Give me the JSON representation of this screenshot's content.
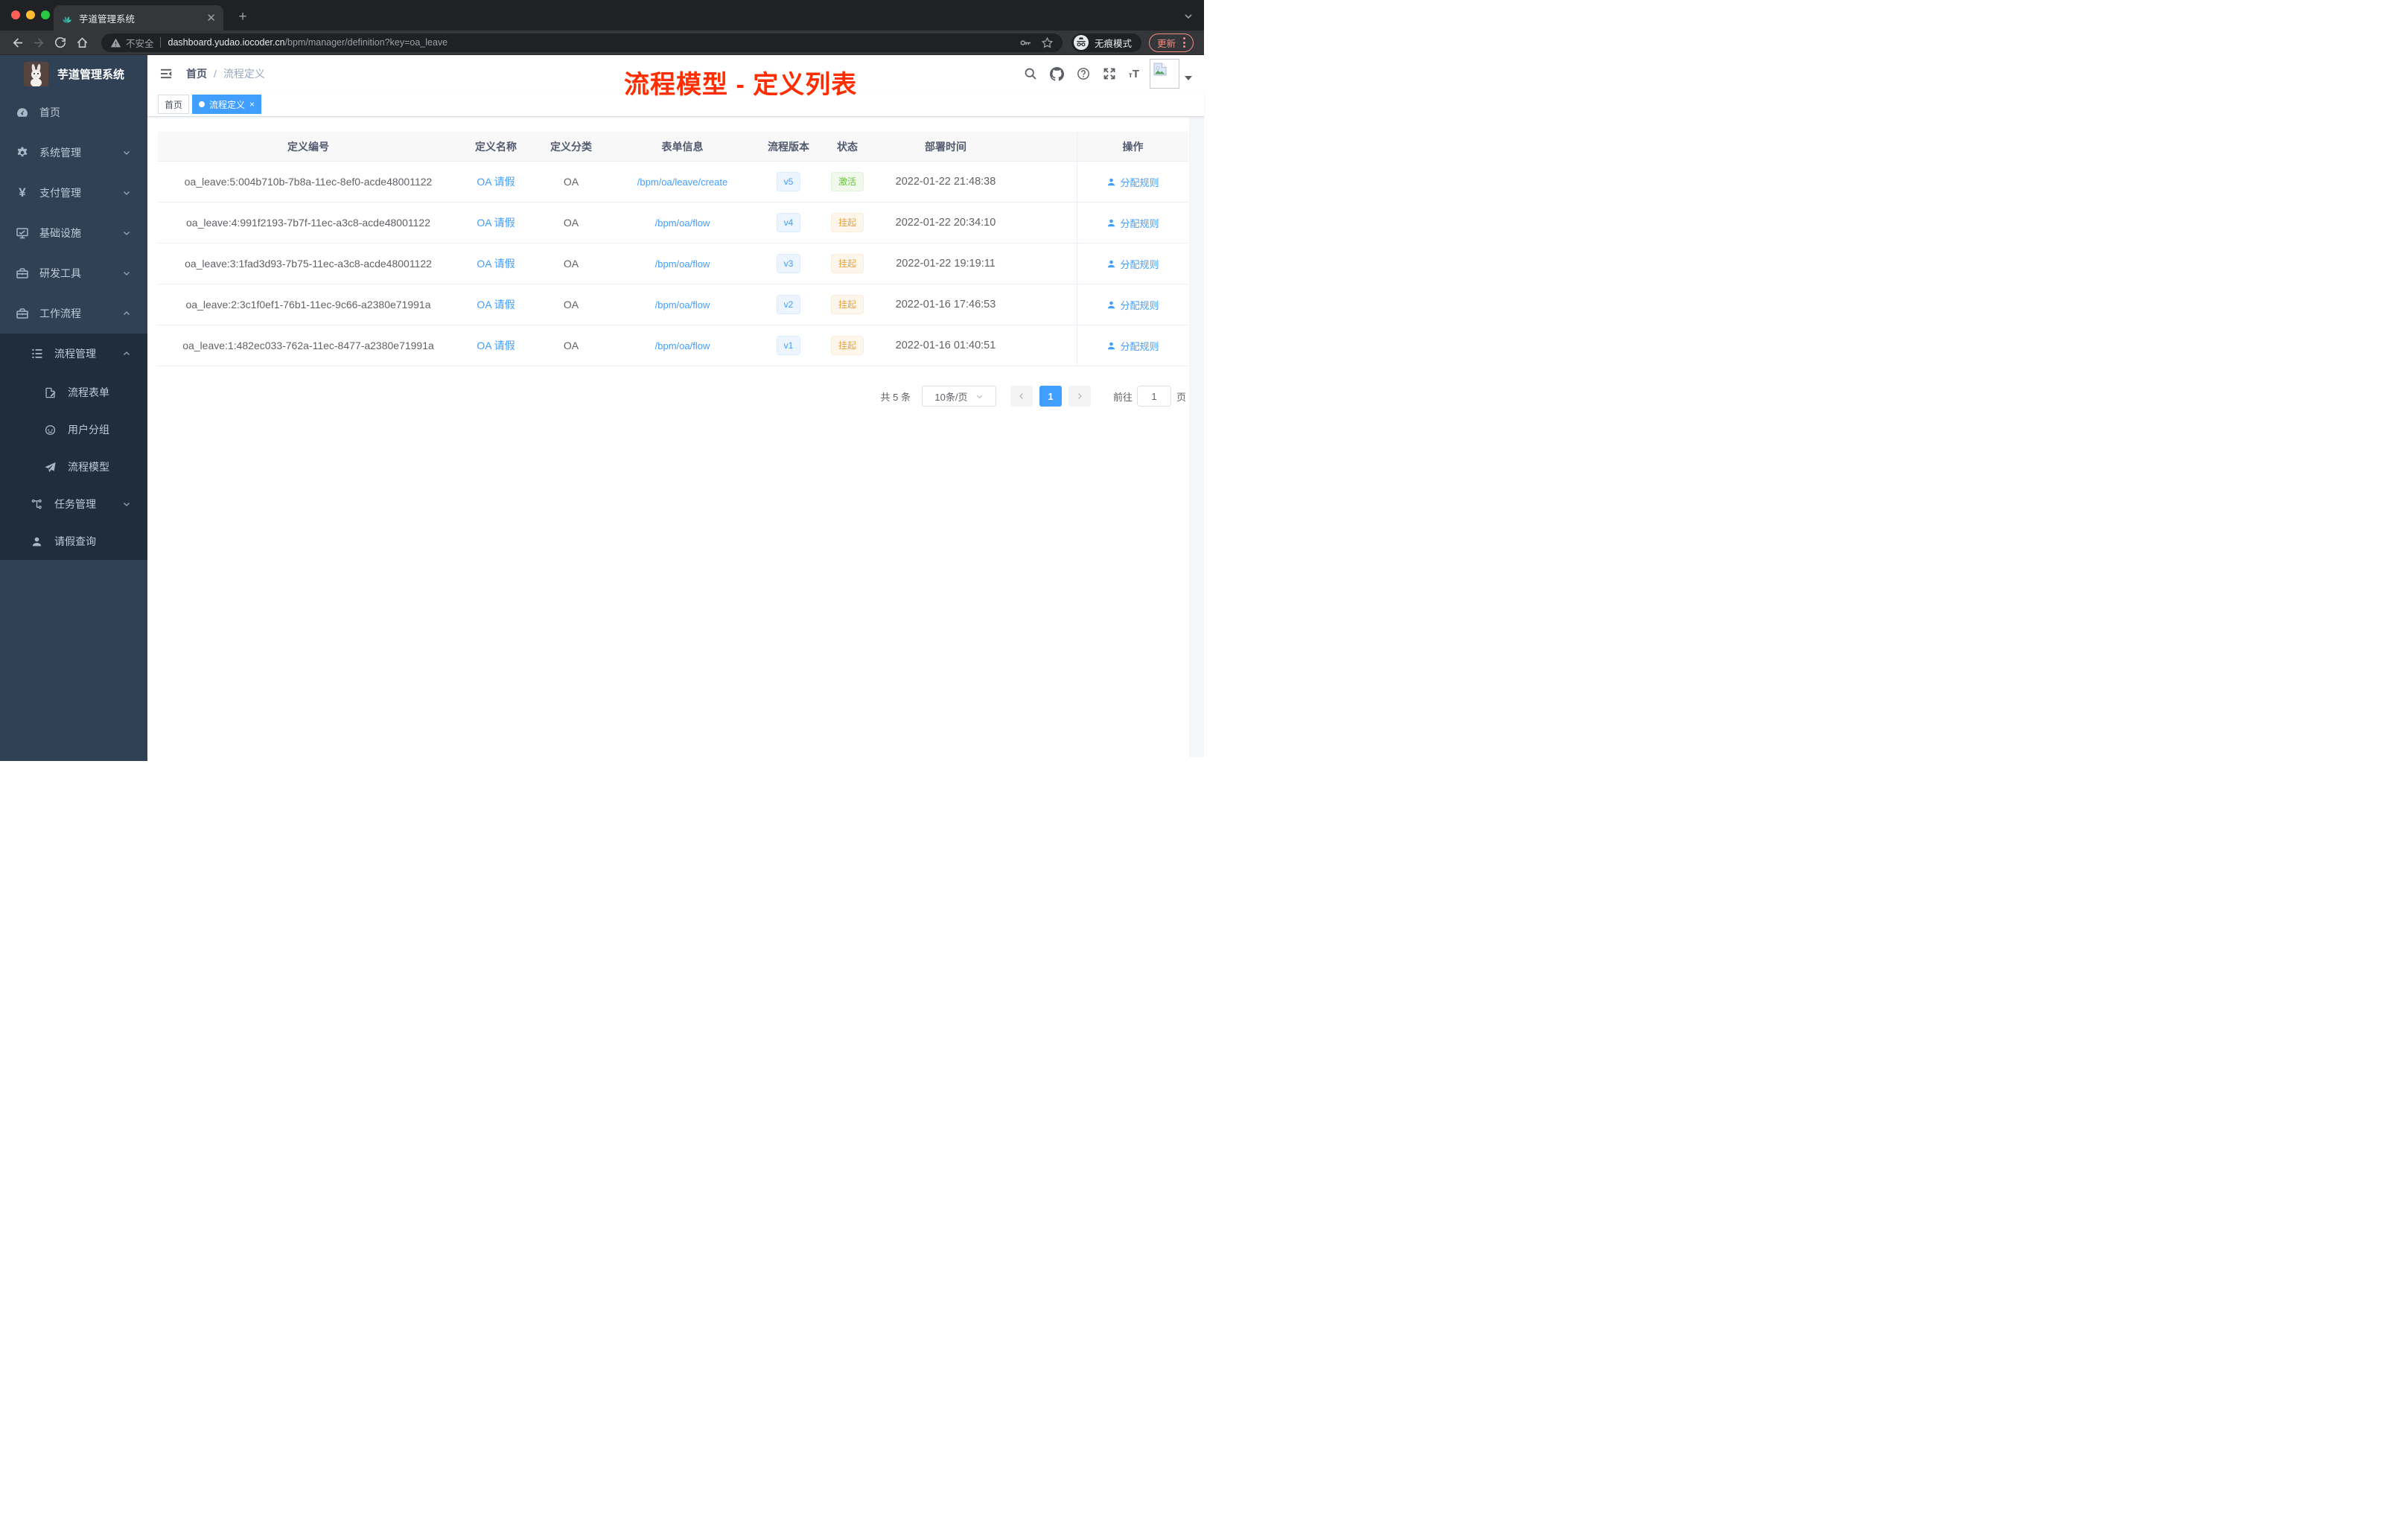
{
  "browser": {
    "tab_title": "芋道管理系统",
    "security_label": "不安全",
    "url_domain": "dashboard.yudao.iocoder.cn",
    "url_path": "/bpm/manager/definition?key=oa_leave",
    "incognito_label": "无痕模式",
    "update_label": "更新"
  },
  "sidebar": {
    "app_title": "芋道管理系统",
    "items": [
      {
        "label": "首页"
      },
      {
        "label": "系统管理"
      },
      {
        "label": "支付管理"
      },
      {
        "label": "基础设施"
      },
      {
        "label": "研发工具"
      },
      {
        "label": "工作流程"
      },
      {
        "label": "流程管理"
      },
      {
        "label": "流程表单"
      },
      {
        "label": "用户分组"
      },
      {
        "label": "流程模型"
      },
      {
        "label": "任务管理"
      },
      {
        "label": "请假查询"
      }
    ]
  },
  "header": {
    "breadcrumb_home": "首页",
    "breadcrumb_current": "流程定义",
    "annotation": "流程模型 - 定义列表"
  },
  "tags": {
    "home": "首页",
    "active": "流程定义"
  },
  "table": {
    "columns": [
      "定义编号",
      "定义名称",
      "定义分类",
      "表单信息",
      "流程版本",
      "状态",
      "部署时间",
      "操作"
    ],
    "rows": [
      {
        "id": "oa_leave:5:004b710b-7b8a-11ec-8ef0-acde48001122",
        "name": "OA 请假",
        "category": "OA",
        "form": "/bpm/oa/leave/create",
        "version": "v5",
        "status": "激活",
        "time": "2022-01-22 21:48:38",
        "action": "分配规则"
      },
      {
        "id": "oa_leave:4:991f2193-7b7f-11ec-a3c8-acde48001122",
        "name": "OA 请假",
        "category": "OA",
        "form": "/bpm/oa/flow",
        "version": "v4",
        "status": "挂起",
        "time": "2022-01-22 20:34:10",
        "action": "分配规则"
      },
      {
        "id": "oa_leave:3:1fad3d93-7b75-11ec-a3c8-acde48001122",
        "name": "OA 请假",
        "category": "OA",
        "form": "/bpm/oa/flow",
        "version": "v3",
        "status": "挂起",
        "time": "2022-01-22 19:19:11",
        "action": "分配规则"
      },
      {
        "id": "oa_leave:2:3c1f0ef1-76b1-11ec-9c66-a2380e71991a",
        "name": "OA 请假",
        "category": "OA",
        "form": "/bpm/oa/flow",
        "version": "v2",
        "status": "挂起",
        "time": "2022-01-16 17:46:53",
        "action": "分配规则"
      },
      {
        "id": "oa_leave:1:482ec033-762a-11ec-8477-a2380e71991a",
        "name": "OA 请假",
        "category": "OA",
        "form": "/bpm/oa/flow",
        "version": "v1",
        "status": "挂起",
        "time": "2022-01-16 01:40:51",
        "action": "分配规则"
      }
    ]
  },
  "pagination": {
    "total": "共 5 条",
    "page_size": "10条/页",
    "page": "1",
    "goto_label": "前往",
    "goto_value": "1",
    "unit": "页"
  },
  "colors": {
    "accent_blue": "#409eff",
    "success_green": "#67c23a",
    "warning_orange": "#e6a23c",
    "annotation_red": "#ff2d00",
    "sidebar_bg": "#304156",
    "submenu_bg": "#1f2d3d"
  }
}
